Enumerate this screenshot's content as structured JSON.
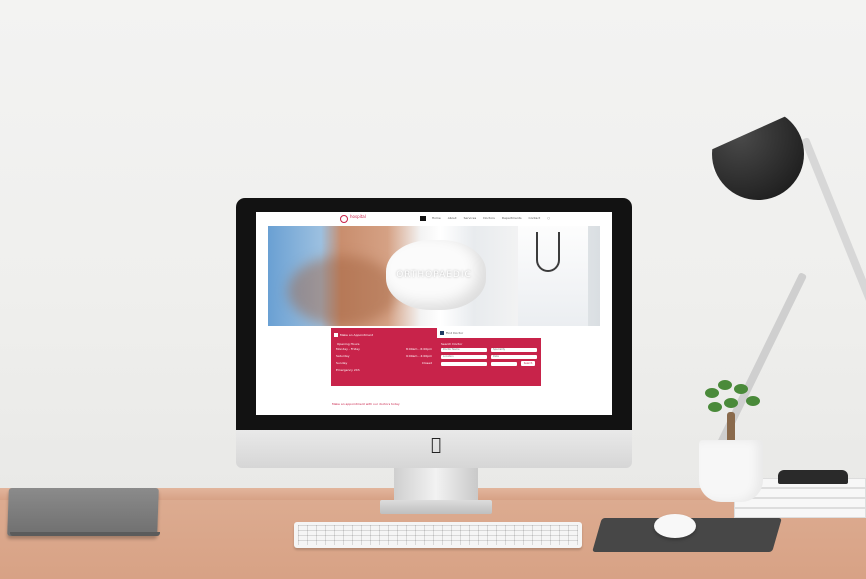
{
  "website": {
    "logo_text": "hospital",
    "nav_items": [
      "",
      "Home",
      "About",
      "Services",
      "Doctors",
      "Departments",
      "Contact"
    ],
    "hero_title": "ORTHOPAEDIC",
    "booking": {
      "tab_left": "Make an Appointment",
      "tab_right": "Find Doctor",
      "col_left_title": "Opening Hours",
      "col_right_title": "Search Doctor",
      "rows": [
        {
          "label": "Monday - Friday",
          "value": "8:00am - 6:00pm"
        },
        {
          "label": "Saturday",
          "value": "9:00am - 4:00pm"
        },
        {
          "label": "Sunday",
          "value": "Closed"
        },
        {
          "label": "Emergency 24h",
          "value": ""
        }
      ],
      "fields": {
        "name_placeholder": "Doctor Name",
        "speciality_placeholder": "Speciality",
        "location_placeholder": "Location",
        "date_placeholder": "Date"
      },
      "search_label": "Search"
    },
    "appointment_link": "Make an appointment with our doctors today"
  },
  "colors": {
    "brand": "#c8234a",
    "nav_active": "#111111",
    "tab_icon": "#1f3b63"
  }
}
